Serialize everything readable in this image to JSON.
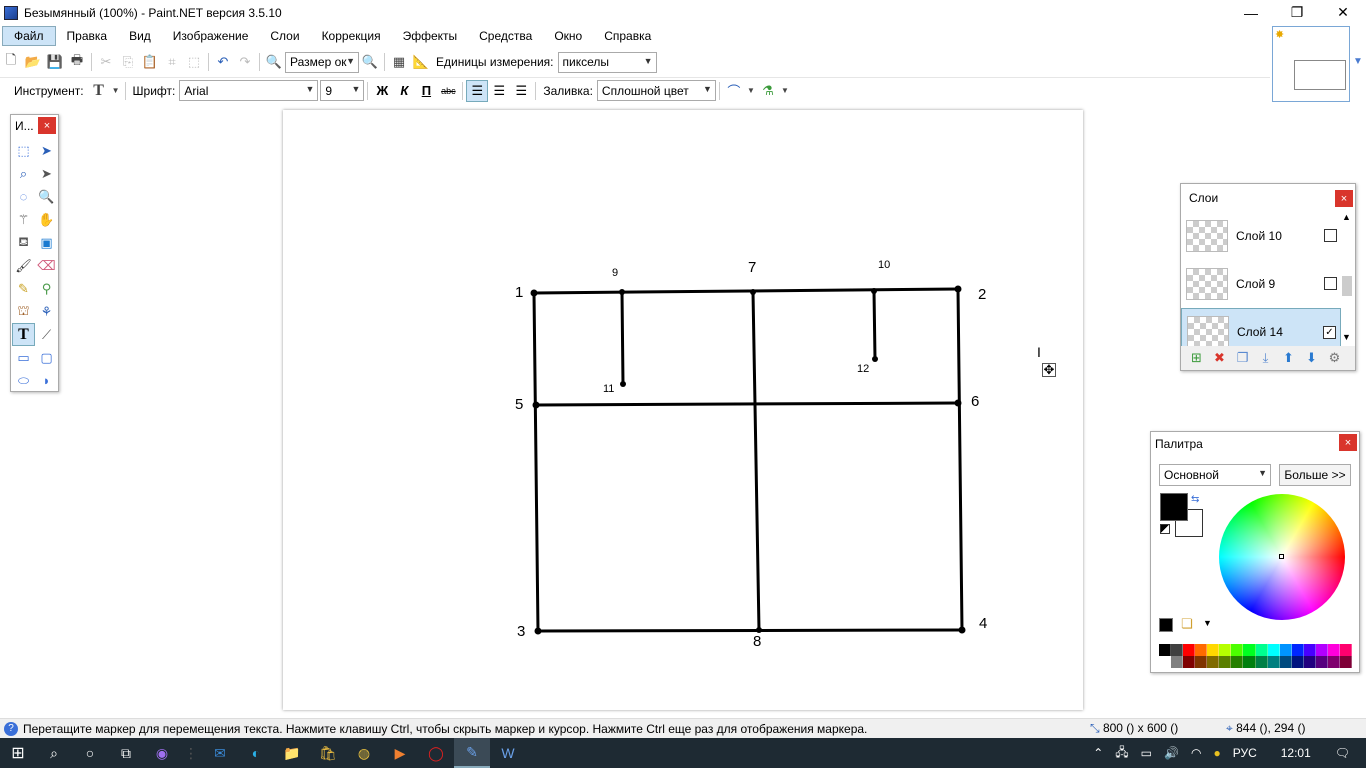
{
  "window": {
    "title": "Безымянный (100%) - Paint.NET версия 3.5.10",
    "minimize": "—",
    "restore": "❐",
    "close": "✕"
  },
  "menu": [
    "Файл",
    "Правка",
    "Вид",
    "Изображение",
    "Слои",
    "Коррекция",
    "Эффекты",
    "Средства",
    "Окно",
    "Справка"
  ],
  "toolbar1": {
    "zoom_value": "Размер ок",
    "units_label": "Единицы измерения:",
    "units_value": "пикселы"
  },
  "toolbar2": {
    "tool_label": "Инструмент:",
    "font_label": "Шрифт:",
    "font_value": "Arial",
    "size_value": "9",
    "bold": "Ж",
    "italic": "К",
    "underline": "П",
    "strike": "abc",
    "fill_label": "Заливка:",
    "fill_value": "Сплошной цвет"
  },
  "tools_panel": {
    "title": "И...",
    "close": "×",
    "tools": [
      "select-rect",
      "move-selection",
      "lasso",
      "move-selected",
      "ellipse-select",
      "zoom",
      "magic-wand",
      "pan",
      "bucket",
      "gradient",
      "brush",
      "eraser",
      "pencil",
      "color-picker",
      "clone-stamp",
      "recolor",
      "text",
      "line-curve",
      "rectangle",
      "rounded-rect",
      "ellipse",
      "freeform"
    ]
  },
  "canvas": {
    "labels": [
      {
        "text": "1"
      },
      {
        "text": "2"
      },
      {
        "text": "3"
      },
      {
        "text": "4"
      },
      {
        "text": "5"
      },
      {
        "text": "6"
      },
      {
        "text": "7"
      },
      {
        "text": "8"
      },
      {
        "text": "9"
      },
      {
        "text": "10"
      },
      {
        "text": "11"
      },
      {
        "text": "12"
      }
    ],
    "cursor": "I",
    "move_handle": "✥"
  },
  "layers": {
    "title": "Слои",
    "close": "×",
    "items": [
      {
        "name": "Слой 10",
        "visible": false
      },
      {
        "name": "Слой 9",
        "visible": false
      },
      {
        "name": "Слой 14",
        "visible": true,
        "selected": true
      }
    ]
  },
  "palette": {
    "title": "Палитра",
    "close": "×",
    "mode_value": "Основной",
    "more_label": "Больше >>",
    "primary_color": "#000000",
    "secondary_color": "#ffffff",
    "swatch_row1": [
      "#000000",
      "#404040",
      "#ff0000",
      "#ff6a00",
      "#ffd800",
      "#b6ff00",
      "#4cff00",
      "#00ff21",
      "#00ff90",
      "#00ffff",
      "#0094ff",
      "#0026ff",
      "#4800ff",
      "#b200ff",
      "#ff00dc",
      "#ff006e"
    ],
    "swatch_row2": [
      "#ffffff",
      "#808080",
      "#7f0000",
      "#7f3300",
      "#7f6a00",
      "#5b7f00",
      "#267f00",
      "#007f0e",
      "#007f46",
      "#007f7f",
      "#004a7f",
      "#00137f",
      "#21007f",
      "#57007f",
      "#7f006e",
      "#7f0037"
    ]
  },
  "status": {
    "help_text": "Перетащите маркер для перемещения текста. Нажмите клавишу Ctrl, чтобы скрыть маркер и курсор. Нажмите Ctrl еще раз для отображения маркера.",
    "image_size": "800 () x 600 ()",
    "cursor_pos": "844 (), 294 ()"
  },
  "taskbar": {
    "lang": "РУС",
    "time": "12:01"
  }
}
